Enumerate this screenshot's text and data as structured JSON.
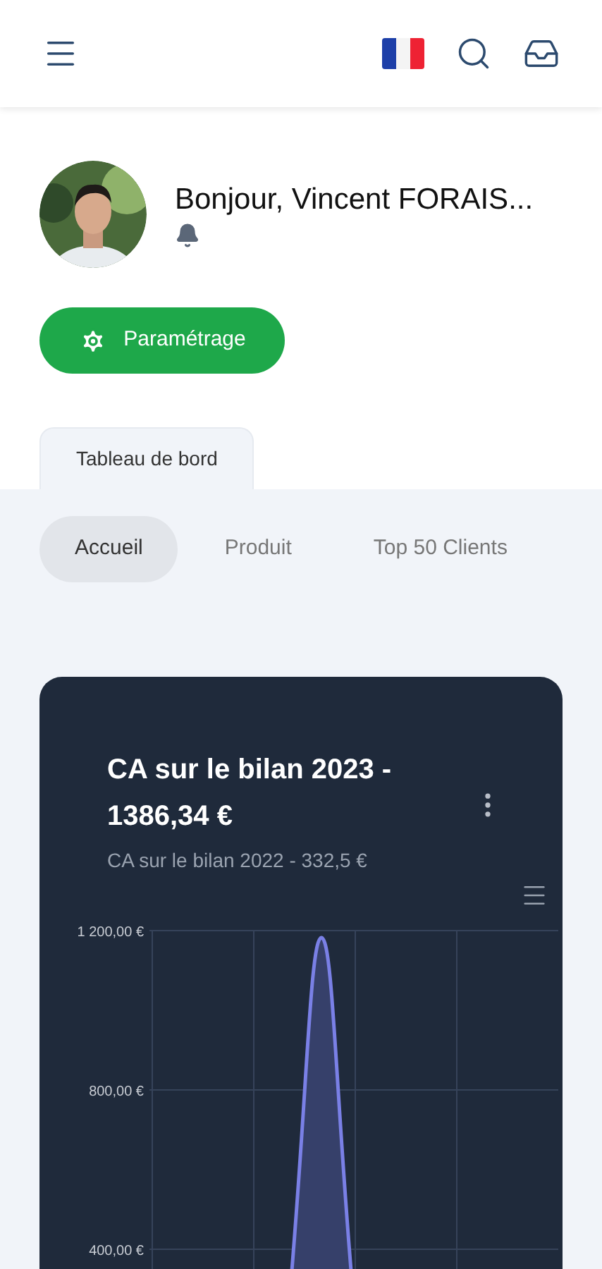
{
  "profile": {
    "greeting": "Bonjour, Vincent FORAIS..."
  },
  "settings_button": {
    "label": "Paramétrage"
  },
  "section_tabs": [
    {
      "label": "Tableau de bord",
      "selected": true
    }
  ],
  "sub_tabs": [
    {
      "label": "Accueil",
      "selected": true
    },
    {
      "label": "Produit",
      "selected": false
    },
    {
      "label": "Top 50 Clients",
      "selected": false
    }
  ],
  "card": {
    "title": "CA sur le bilan 2023 - 1386,34 €",
    "subtitle": "CA sur le bilan 2022 - 332,5 €",
    "y_labels": [
      "1 200,00 €",
      "800,00 €",
      "400,00 €"
    ]
  }
}
